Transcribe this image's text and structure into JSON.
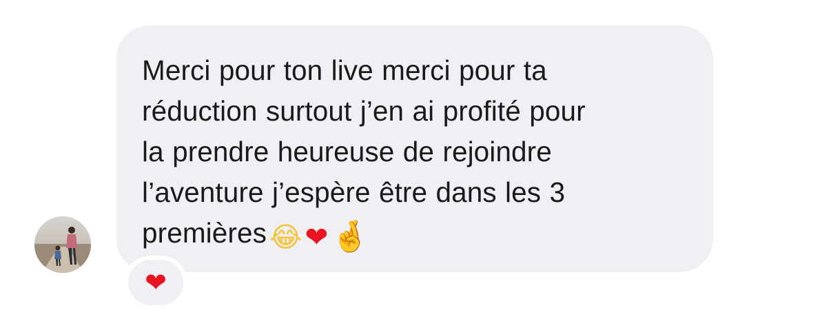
{
  "message": {
    "lines": [
      "Merci pour ton live merci pour ta",
      "réduction surtout j’en ai profité pour",
      "la prendre heureuse de rejoindre",
      "l’aventure j’espère être dans les 3",
      "premières"
    ],
    "emojis": [
      {
        "name": "face-with-tears-of-joy",
        "glyph": "😂"
      },
      {
        "name": "red-heart",
        "glyph": "❤"
      },
      {
        "name": "crossed-fingers",
        "glyph": "🤞"
      }
    ]
  },
  "reaction": {
    "name": "red-heart",
    "glyph": "❤"
  },
  "colors": {
    "bubble": "#efeff4",
    "text": "#1a1a1a",
    "heart": "#e8141f"
  }
}
